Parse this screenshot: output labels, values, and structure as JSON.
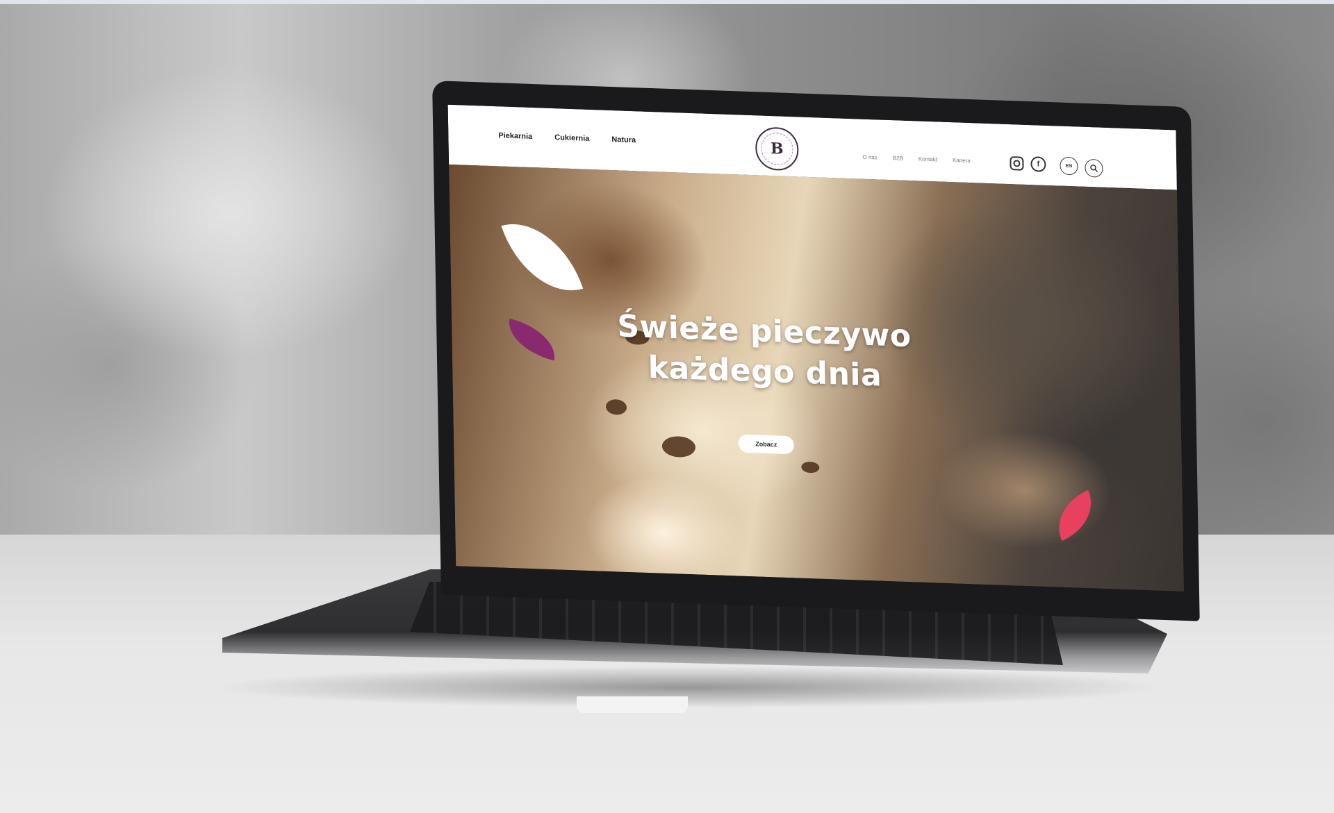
{
  "site": {
    "nav_left": [
      "Piekarnia",
      "Cukiernia",
      "Natura"
    ],
    "nav_right": [
      "O nas",
      "B2B",
      "Kontakt",
      "Kariera"
    ],
    "logo_letter": "B",
    "lang_label": "EN",
    "social": [
      "instagram-icon",
      "facebook-icon"
    ],
    "fb_glyph": "f"
  },
  "hero": {
    "title_line1": "Świeże pieczywo",
    "title_line2": "każdego dnia",
    "button_label": "Zobacz"
  },
  "colors": {
    "accent_purple": "#8a2a6e",
    "accent_pink": "#e8415f",
    "header_bg": "#ffffff"
  }
}
